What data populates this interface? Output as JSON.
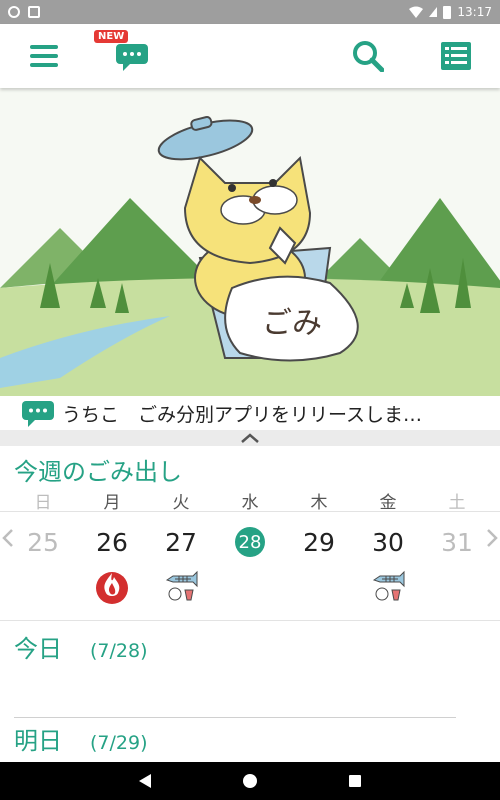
{
  "status_bar": {
    "time": "13:17"
  },
  "toolbar": {
    "new_badge": "NEW"
  },
  "colors": {
    "accent": "#26a285",
    "fire": "#d32f2f",
    "muted": "#bdbdbd"
  },
  "banner": {
    "bag_text": "ごみ"
  },
  "notice": {
    "text": "うちこ　ごみ分別アプリをリリースしま…"
  },
  "week": {
    "title": "今週のごみ出し",
    "weekdays": [
      "日",
      "月",
      "火",
      "水",
      "木",
      "金",
      "土"
    ],
    "dates": [
      "25",
      "26",
      "27",
      "28",
      "29",
      "30",
      "31"
    ],
    "today_index": 3,
    "icons": [
      "",
      "burnable-fire-icon",
      "resource-fishbone-icon",
      "",
      "",
      "resource-fishbone-icon",
      ""
    ]
  },
  "today": {
    "label": "今日",
    "date": "(7/28)"
  },
  "tomorrow": {
    "label": "明日",
    "date": "(7/29)"
  }
}
